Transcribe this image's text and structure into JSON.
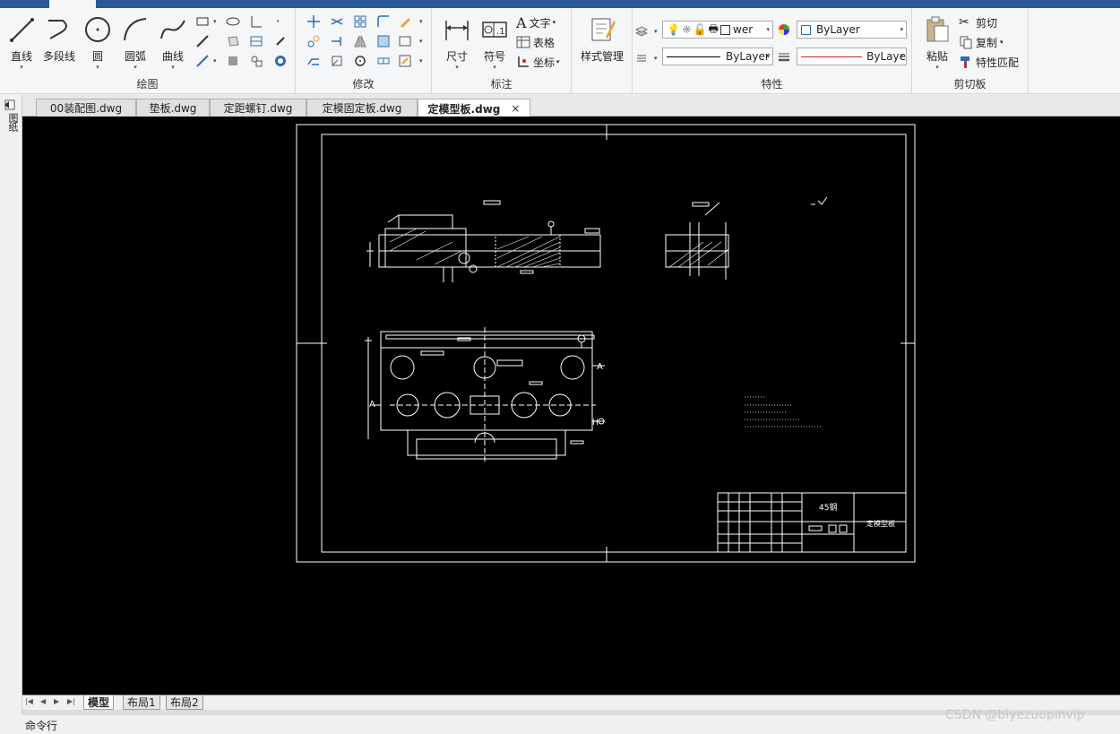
{
  "ribbon": {
    "draw": {
      "title": "绘图",
      "line": "直线",
      "polyline": "多段线",
      "circle": "圆",
      "arc": "圆弧",
      "curve": "曲线"
    },
    "modify": {
      "title": "修改"
    },
    "annotation": {
      "title": "标注",
      "dimension": "尺寸",
      "symbol": "符号",
      "text": "文字",
      "table": "表格",
      "coordinate": "坐标"
    },
    "style": {
      "label": "样式管理"
    },
    "properties": {
      "title": "特性",
      "layer_name": "wer",
      "color": "ByLayer",
      "linetype": "ByLayer",
      "lineweight": "ByLaye",
      "lineweight_color": "#d02020"
    },
    "clipboard": {
      "title": "剪切板",
      "paste": "粘贴",
      "cut": "剪切",
      "copy": "复制",
      "match": "特性匹配"
    }
  },
  "doc_tabs": [
    "00装配图.dwg",
    "垫板.dwg",
    "定距螺钉.dwg",
    "定模固定板.dwg",
    "定模型板.dwg"
  ],
  "sidebar_label": "图纸",
  "layout_tabs": [
    "模型",
    "布局1",
    "布局2"
  ],
  "command_label": "命令行",
  "watermark": "CSDN @biyezuopinvip",
  "drawing": {
    "material": "45钢",
    "part_name": "定模型板",
    "label_a": "A",
    "label_b": "A",
    "label_h": "H"
  }
}
